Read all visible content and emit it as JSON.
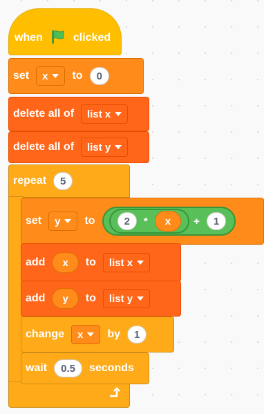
{
  "hat": {
    "when": "when",
    "clicked": "clicked",
    "icon": "green-flag-icon"
  },
  "set_x": {
    "label": "set",
    "var": "x",
    "to": "to",
    "value": "0"
  },
  "delete_x": {
    "label": "delete all of",
    "list": "list x"
  },
  "delete_y": {
    "label": "delete all of",
    "list": "list y"
  },
  "repeat": {
    "label": "repeat",
    "count": "5"
  },
  "set_y": {
    "label": "set",
    "var": "y",
    "to": "to",
    "mult_left": "2",
    "mult_op": "*",
    "mult_right": "x",
    "add_op": "+",
    "add_right": "1"
  },
  "add_x": {
    "label": "add",
    "item": "x",
    "to": "to",
    "list": "list x"
  },
  "add_y": {
    "label": "add",
    "item": "y",
    "to": "to",
    "list": "list y"
  },
  "change_x": {
    "label": "change",
    "var": "x",
    "by": "by",
    "value": "1"
  },
  "wait": {
    "label": "wait",
    "value": "0.5",
    "unit": "seconds"
  },
  "colors": {
    "events": "#ffbf00",
    "variables": "#ff8c1a",
    "lists": "#ff661a",
    "control": "#ffab19",
    "operators": "#59c059"
  },
  "loop_icon": "loop-arrow-icon"
}
